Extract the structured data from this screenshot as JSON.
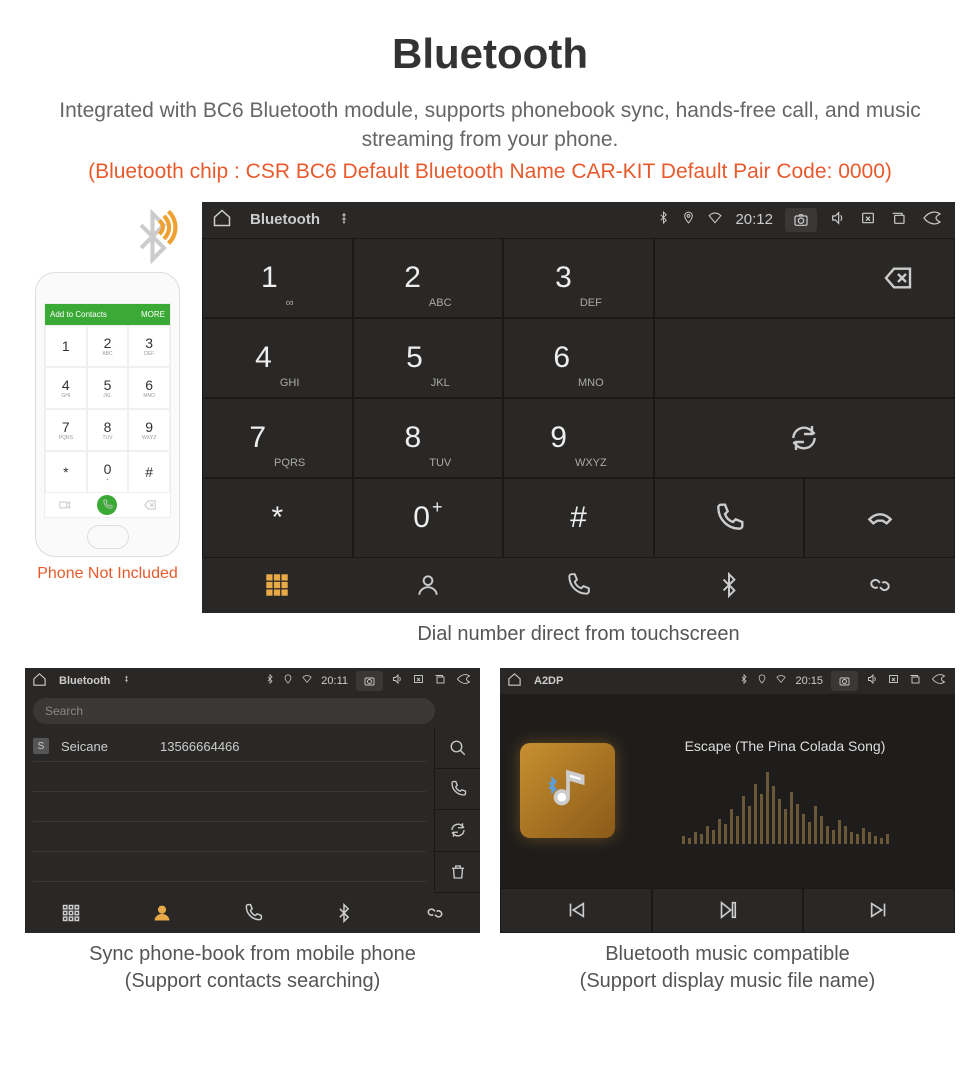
{
  "page": {
    "title": "Bluetooth",
    "subtitle": "Integrated with BC6 Bluetooth module, supports phonebook sync, hands-free call, and music streaming from your phone.",
    "info_line": "(Bluetooth chip : CSR BC6     Default Bluetooth Name CAR-KIT     Default Pair Code: 0000)"
  },
  "phone": {
    "header": "Add to Contacts",
    "header_more": "MORE",
    "keys": [
      {
        "d": "1",
        "s": ""
      },
      {
        "d": "2",
        "s": "ABC"
      },
      {
        "d": "3",
        "s": "DEF"
      },
      {
        "d": "4",
        "s": "GHI"
      },
      {
        "d": "5",
        "s": "JKL"
      },
      {
        "d": "6",
        "s": "MNO"
      },
      {
        "d": "7",
        "s": "PQRS"
      },
      {
        "d": "8",
        "s": "TUV"
      },
      {
        "d": "9",
        "s": "WXYZ"
      },
      {
        "d": "*",
        "s": ""
      },
      {
        "d": "0",
        "s": "+"
      },
      {
        "d": "#",
        "s": ""
      }
    ],
    "caption": "Phone Not Included"
  },
  "dialer": {
    "status": {
      "app_label": "Bluetooth",
      "time": "20:12"
    },
    "keys": [
      {
        "d": "1",
        "s": "∞"
      },
      {
        "d": "2",
        "s": "ABC"
      },
      {
        "d": "3",
        "s": "DEF"
      },
      {
        "d": "4",
        "s": "GHI"
      },
      {
        "d": "5",
        "s": "JKL"
      },
      {
        "d": "6",
        "s": "MNO"
      },
      {
        "d": "7",
        "s": "PQRS"
      },
      {
        "d": "8",
        "s": "TUV"
      },
      {
        "d": "9",
        "s": "WXYZ"
      },
      {
        "d": "*",
        "s": ""
      },
      {
        "d": "0",
        "s": "+"
      },
      {
        "d": "#",
        "s": ""
      }
    ],
    "caption": "Dial number direct from touchscreen"
  },
  "phonebook": {
    "status": {
      "app_label": "Bluetooth",
      "time": "20:11"
    },
    "search_placeholder": "Search",
    "contact": {
      "badge": "S",
      "name": "Seicane",
      "number": "13566664466"
    },
    "caption_line1": "Sync phone-book from mobile phone",
    "caption_line2": "(Support contacts searching)"
  },
  "music": {
    "status": {
      "app_label": "A2DP",
      "time": "20:15"
    },
    "song": "Escape (The Pina Colada Song)",
    "caption_line1": "Bluetooth music compatible",
    "caption_line2": "(Support display music file name)"
  }
}
